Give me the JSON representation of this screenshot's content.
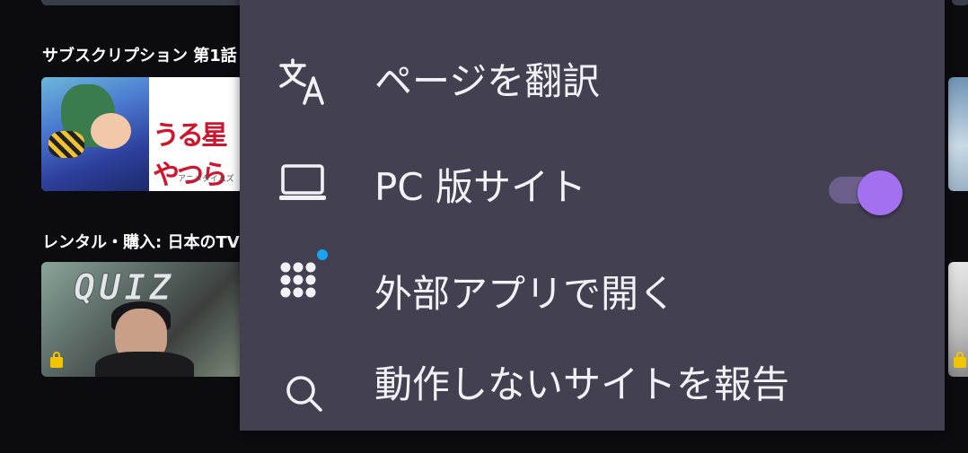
{
  "shelves": [
    {
      "title": "サブスクリプション 第1話"
    },
    {
      "title": "レンタル・購入: 日本のTV"
    }
  ],
  "thumbnails": {
    "t1": {
      "logo": "うる星やつら",
      "brand": "アニメタイムズ"
    },
    "t2": {
      "overlay_text": "QUIZ",
      "badge_icon": "lock-icon"
    }
  },
  "menu": {
    "items": [
      {
        "label": "ページを翻訳",
        "icon": "translate-icon"
      },
      {
        "label": "PC 版サイト",
        "icon": "laptop-icon",
        "toggle_on": true
      },
      {
        "label": "外部アプリで開く",
        "icon": "apps-grid-icon",
        "has_dot": true
      },
      {
        "label": "動作しないサイトを報告",
        "icon": "search-icon"
      }
    ]
  },
  "colors": {
    "menu_bg": "#434051",
    "toggle_accent": "#a370f0",
    "notification_dot": "#1aa3f0",
    "badge": "#f2c500"
  }
}
